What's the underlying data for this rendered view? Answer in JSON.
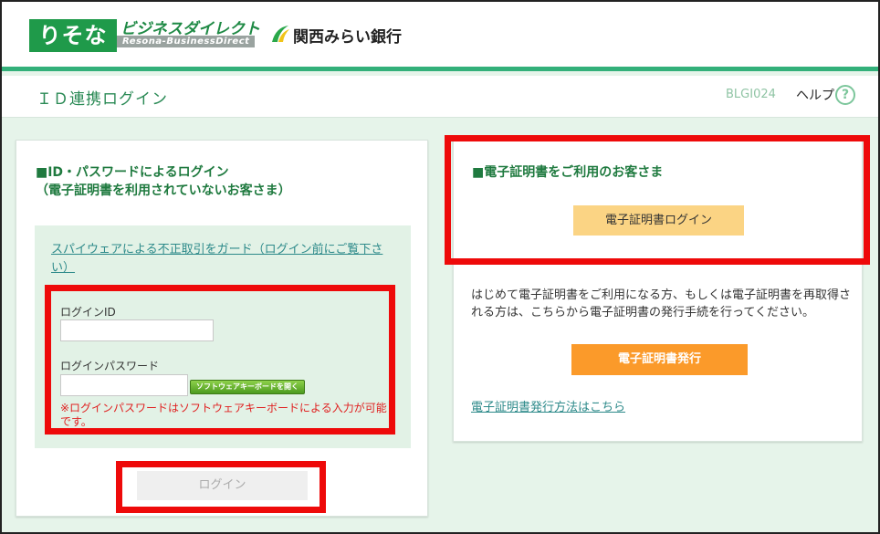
{
  "header": {
    "resona_logo": "りそな",
    "business_direct_jp": "ビジネスダイレクト",
    "business_direct_en": "Resona-BusinessDirect",
    "partner_bank": "関西みらい銀行",
    "brand_color": "#1f9a4a",
    "accent_color": "#33b07a"
  },
  "titlebar": {
    "title": "ＩＤ連携ログイン",
    "screen_id": "BLGI024",
    "help_label": "ヘルプ",
    "help_icon": "question-circle-icon",
    "help_glyph": "?"
  },
  "left_panel": {
    "title_line1": "■ID・パスワードによるログイン",
    "title_line2": "（電子証明書を利用されていないお客さま）",
    "spyware_link": "スパイウェアによる不正取引をガード（ログイン前にご覧下さい）",
    "login_id_label": "ログインID",
    "login_id_value": "",
    "password_label": "ログインパスワード",
    "password_value": "",
    "keyboard_button": "ソフトウェアキーボードを開く",
    "password_note": "※ログインパスワードはソフトウェアキーボードによる入力が可能です。",
    "login_button": "ログイン"
  },
  "right_panel": {
    "title": "■電子証明書をご利用のお客さま",
    "cert_login_button": "電子証明書ログイン",
    "info_text": "はじめて電子証明書をご利用になる方、もしくは電子証明書を再取得される方は、こちらから電子証明書の発行手続を行ってください。",
    "cert_issue_button": "電子証明書発行",
    "cert_howto_link": "電子証明書発行方法はこちら"
  },
  "colors": {
    "highlight_red": "#ee0a0a",
    "issue_orange": "#fb9a2a",
    "cert_login_yellow": "#fbd484"
  }
}
